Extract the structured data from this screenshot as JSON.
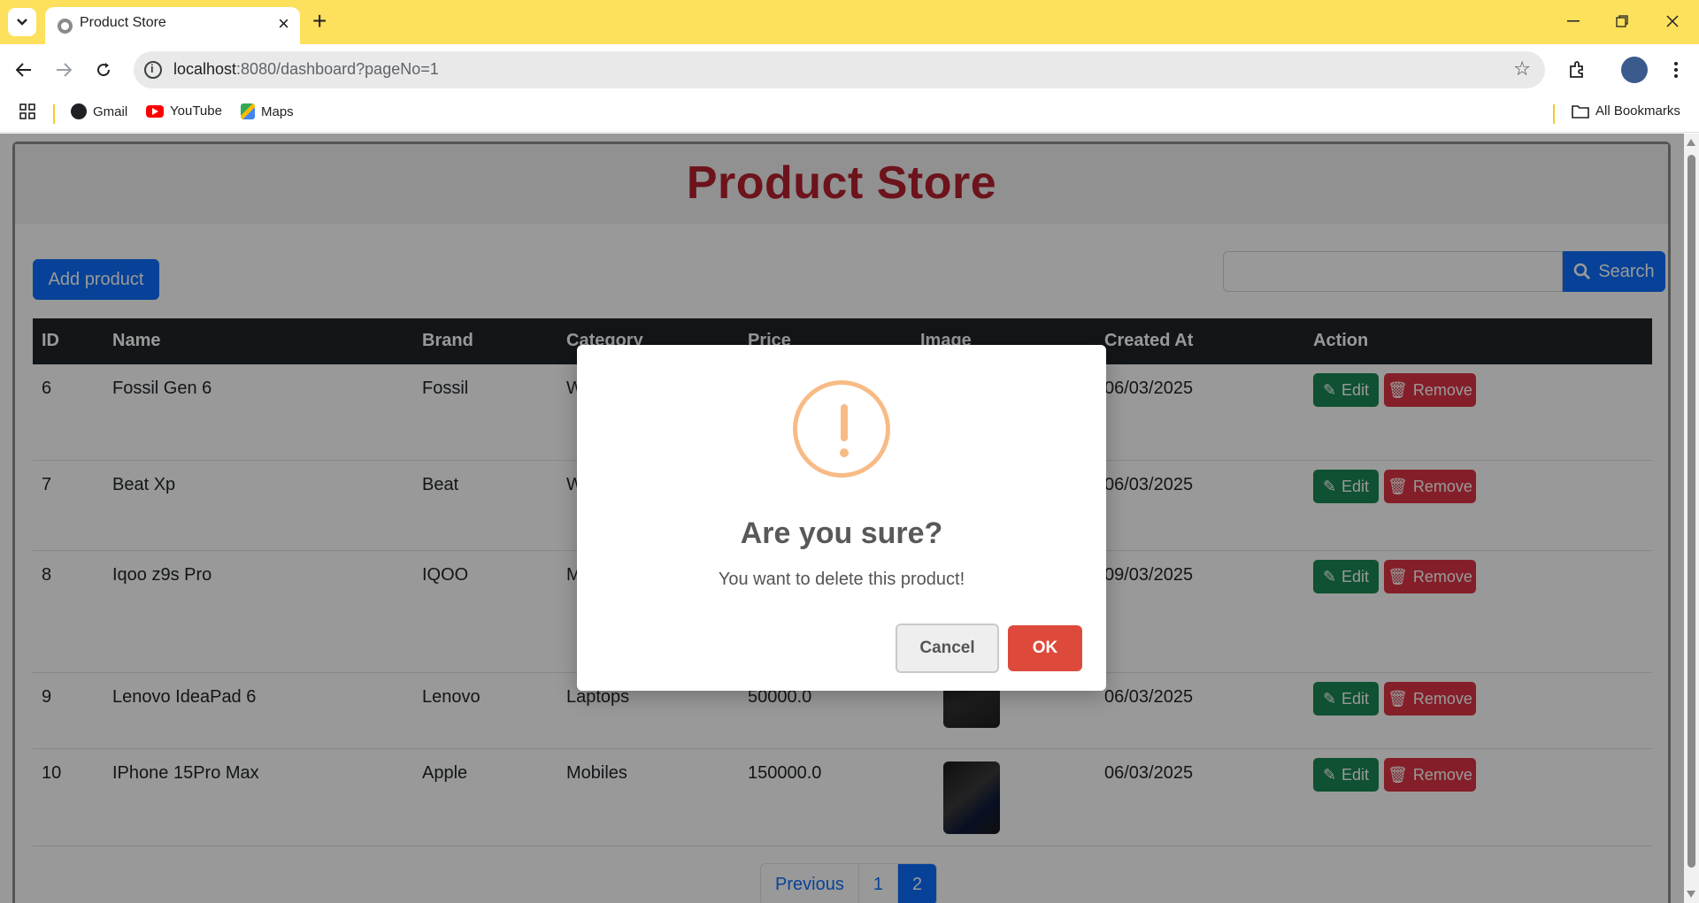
{
  "browser": {
    "tab_title": "Product Store",
    "url_host": "localhost",
    "url_rest": ":8080/dashboard?pageNo=1",
    "bookmarks": [
      "Gmail",
      "YouTube",
      "Maps"
    ],
    "all_bookmarks": "All Bookmarks"
  },
  "page": {
    "title": "Product Store",
    "add_button": "Add product",
    "search_button": "Search",
    "search_value": ""
  },
  "table": {
    "headers": [
      "ID",
      "Name",
      "Brand",
      "Category",
      "Price",
      "Image",
      "Created At",
      "Action"
    ],
    "rows": [
      {
        "id": "6",
        "name": "Fossil Gen 6",
        "brand": "Fossil",
        "category": "W",
        "price": "",
        "created": "06/03/2025"
      },
      {
        "id": "7",
        "name": "Beat Xp",
        "brand": "Beat",
        "category": "W",
        "price": "",
        "created": "06/03/2025"
      },
      {
        "id": "8",
        "name": "Iqoo z9s Pro",
        "brand": "IQOO",
        "category": "M",
        "price": "",
        "created": "09/03/2025"
      },
      {
        "id": "9",
        "name": "Lenovo IdeaPad 6",
        "brand": "Lenovo",
        "category": "Laptops",
        "price": "50000.0",
        "created": "06/03/2025"
      },
      {
        "id": "10",
        "name": "IPhone 15Pro Max",
        "brand": "Apple",
        "category": "Mobiles",
        "price": "150000.0",
        "created": "06/03/2025"
      }
    ],
    "edit_label": "Edit",
    "remove_label": "Remove"
  },
  "pagination": {
    "previous": "Previous",
    "pages": [
      "1",
      "2"
    ],
    "active": "2"
  },
  "modal": {
    "title": "Are you sure?",
    "text": "You want to delete this product!",
    "cancel": "Cancel",
    "ok": "OK"
  },
  "colors": {
    "title": "#b4202f",
    "primary": "#0d6efd",
    "success": "#198754",
    "danger": "#dc3545",
    "warning_icon": "#f8bb86",
    "confirm": "#dd4a3b",
    "chrome_titlebar": "#fde05c"
  },
  "icons": [
    "chevron-down-icon",
    "globe-icon",
    "close-icon",
    "plus-icon",
    "minimize-icon",
    "restore-icon",
    "back-icon",
    "forward-icon",
    "reload-icon",
    "info-icon",
    "star-icon",
    "extensions-icon",
    "avatar",
    "kebab-menu-icon",
    "apps-grid-icon",
    "folder-icon",
    "search-icon",
    "pencil-icon",
    "trash-icon",
    "exclamation-icon"
  ]
}
